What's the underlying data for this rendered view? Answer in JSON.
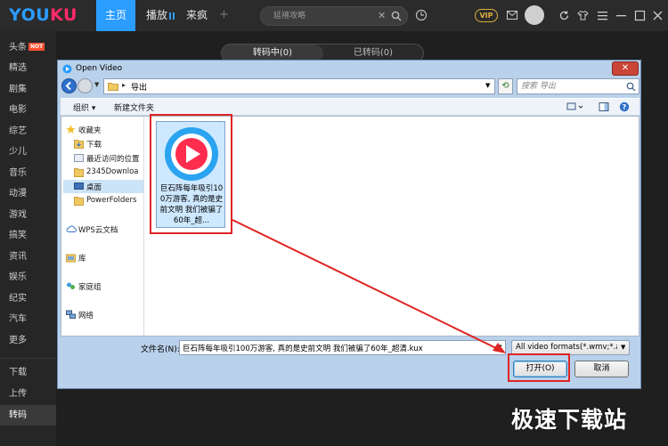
{
  "app": {
    "logo_part1": "YOU",
    "logo_part2": "KU",
    "nav": [
      "主页",
      "播放",
      "来疯"
    ],
    "add_tab": "+",
    "search_placeholder": "延禧攻略",
    "vip": "VIP"
  },
  "sidebar": {
    "hot_badge": "NOT",
    "items": [
      "头条",
      "精选",
      "剧集",
      "电影",
      "综艺",
      "少儿",
      "音乐",
      "动漫",
      "游戏",
      "搞笑",
      "资讯",
      "娱乐",
      "纪实",
      "汽车",
      "更多",
      "下载",
      "上传",
      "转码"
    ],
    "active": "转码"
  },
  "content_tabs": [
    "转码中(0)",
    "已转码(0)"
  ],
  "dialog": {
    "title": "Open Video",
    "close": "✕",
    "address_path": "导出",
    "search_placeholder": "搜索 导出",
    "toolbar": {
      "organize": "组织 ▾",
      "new_folder": "新建文件夹"
    },
    "nav_pane": {
      "favorites": "收藏夹",
      "downloads": "下载",
      "recent": "最近访问的位置",
      "folder_2345": "2345Downloa",
      "desktop": "桌面",
      "powerfolders": "PowerFolders",
      "wps": "WPS云文档",
      "library": "库",
      "homegroup": "家庭组",
      "network": "网络"
    },
    "file": {
      "name": "巨石阵每年吸引100万游客, 真的是史前文明 我们被骗了60年_超..."
    },
    "filename_label": "文件名(N):",
    "filename_value": "巨石阵每年吸引100万游客, 真的是史前文明 我们被骗了60年_超清.kux",
    "filetype": "All video formats(*.wmv;*.avi",
    "open_button": "打开(O)",
    "cancel_button": "取消"
  },
  "watermark": "极速下载站",
  "colors": {
    "brand_blue": "#2a9dff",
    "brand_pink": "#ff2a6a",
    "highlight_red": "#e02424"
  }
}
